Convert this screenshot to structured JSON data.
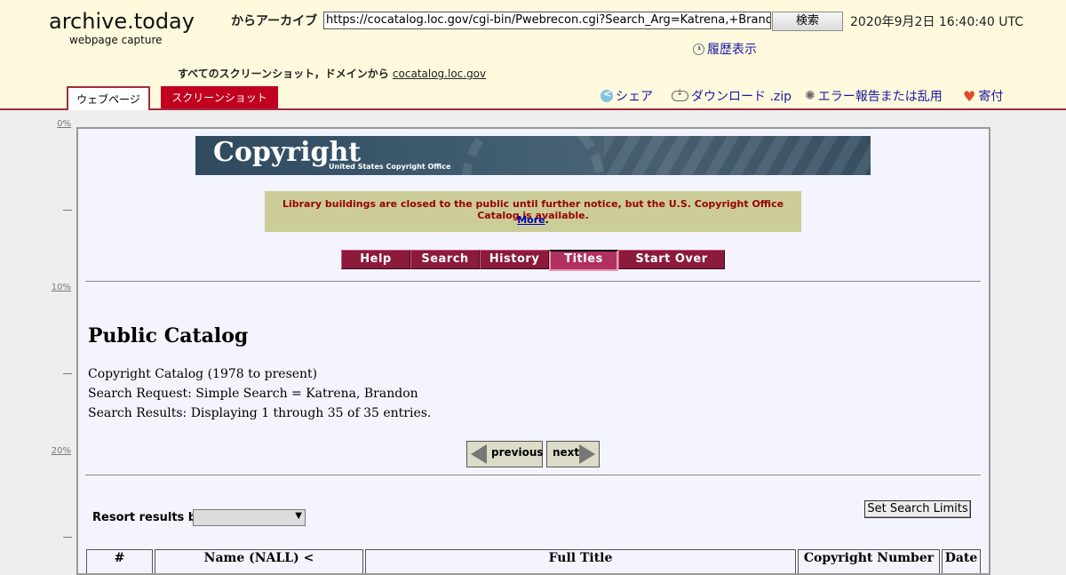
{
  "archive": {
    "logo": "archive.today",
    "logo_sub": "webpage capture",
    "archive_label": "からアーカイブ",
    "url_value": "https://cocatalog.loc.gov/cgi-bin/Pwebrecon.cgi?Search_Arg=Katrena,+Brandon&Search",
    "search_button": "検索",
    "timestamp": "2020年9月2日 16:40:40 UTC",
    "history_link": "履歴表示",
    "domain_prefix": "すべてのスクリーンショット，ドメインから",
    "domain_link": "cocatalog.loc.gov",
    "tabs": {
      "webpage": "ウェブページ",
      "screenshot": "スクリーンショット"
    },
    "actions": {
      "share": "シェア",
      "download": "ダウンロード .zip",
      "report": "エラー報告または乱用",
      "donate": "寄付"
    },
    "ruler": [
      "0%",
      "10%",
      "20%"
    ]
  },
  "page": {
    "banner_title": "Copyright",
    "banner_sub": "United States Copyright Office",
    "notice": "Library buildings are closed to the public until further notice, but the U.S. Copyright Office Catalog is available.",
    "notice_more": "More",
    "nav": [
      "Help",
      "Search",
      "History",
      "Titles",
      "Start Over"
    ],
    "nav_active": "Titles",
    "title": "Public Catalog",
    "catalog_line": "Copyright Catalog (1978 to present)",
    "search_request": "Search Request: Simple Search = Katrena, Brandon",
    "search_results": "Search Results: Displaying 1 through 35 of 35 entries.",
    "prev": "previous",
    "next": "next",
    "resort_label": "Resort results by:",
    "resort_value": "",
    "limits_button": "Set Search Limits",
    "table_headers": [
      "#",
      "Name (NALL) <",
      "Full Title",
      "Copyright Number",
      "Date"
    ]
  },
  "colors": {
    "header_bg": "#fff9dd",
    "accent": "#a22c3c",
    "nav_button": "#8b1a3b",
    "notice_bg": "#cccc99",
    "notice_text": "#990000"
  }
}
